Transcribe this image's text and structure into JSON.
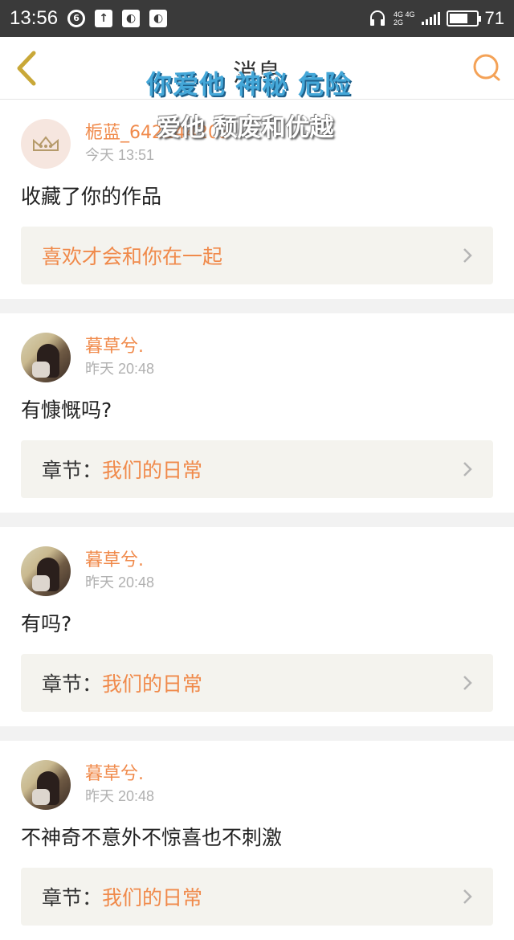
{
  "status_bar": {
    "time": "13:56",
    "network_top": "4G 4G",
    "network_bottom": "2G",
    "battery_level": "71"
  },
  "header": {
    "title": "消息"
  },
  "overlay": {
    "line1": "你爱他 神秘 危险",
    "line2": "爱他 颓废和优越"
  },
  "messages": [
    {
      "username": "栀蓝_642244203",
      "time": "今天 13:51",
      "content": "收藏了你的作品",
      "ref_prefix": "",
      "ref_text": "喜欢才会和你在一起"
    },
    {
      "username": "暮草兮.",
      "time": "昨天 20:48",
      "content": "有慷慨吗?",
      "ref_prefix": "章节：",
      "ref_text": "我们的日常"
    },
    {
      "username": "暮草兮.",
      "time": "昨天 20:48",
      "content": "有吗?",
      "ref_prefix": "章节：",
      "ref_text": "我们的日常"
    },
    {
      "username": "暮草兮.",
      "time": "昨天 20:48",
      "content": "不神奇不意外不惊喜也不刺激",
      "ref_prefix": "章节：",
      "ref_text": "我们的日常"
    }
  ],
  "colors": {
    "accent": "#f08a4b",
    "status_bar": "#3a3a3a",
    "overlay_blue": "#44a7d8"
  },
  "icons": [
    "netease-icon",
    "upload-icon",
    "qq-icon",
    "headset-icon",
    "back-icon",
    "search-icon",
    "chevron-right-icon"
  ]
}
